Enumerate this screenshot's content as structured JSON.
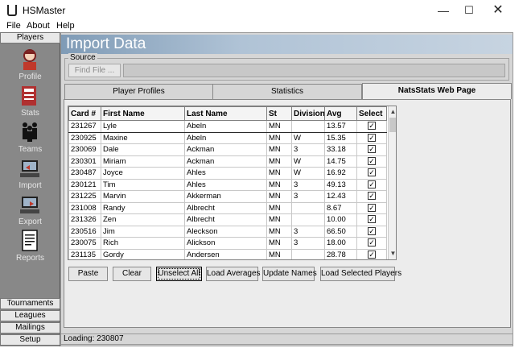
{
  "window": {
    "title": "HSMaster",
    "minimize": "—",
    "maximize": "☐",
    "close": "✕"
  },
  "menu": [
    "File",
    "About",
    "Help"
  ],
  "sidebar": {
    "header": "Players",
    "items": [
      {
        "label": "Profile",
        "icon": "profile-icon"
      },
      {
        "label": "Stats",
        "icon": "stats-icon"
      },
      {
        "label": "Teams",
        "icon": "teams-icon"
      },
      {
        "label": "Import",
        "icon": "import-icon"
      },
      {
        "label": "Export",
        "icon": "export-icon"
      },
      {
        "label": "Reports",
        "icon": "reports-icon"
      }
    ],
    "bottom": [
      "Tournaments",
      "Leagues",
      "Mailings",
      "Setup"
    ]
  },
  "page": {
    "title": "Import Data",
    "source_label": "Source",
    "find_file": "Find File ..."
  },
  "tabs": [
    {
      "label": "Player Profiles",
      "active": false
    },
    {
      "label": "Statistics",
      "active": false
    },
    {
      "label": "NatsStats Web Page",
      "active": true
    }
  ],
  "grid": {
    "columns": [
      "Card #",
      "First Name",
      "Last Name",
      "St",
      "Division",
      "Avg",
      "Select"
    ],
    "rows": [
      [
        "231267",
        "Lyle",
        "Abeln",
        "MN",
        "",
        "13.57",
        true
      ],
      [
        "230925",
        "Maxine",
        "Abeln",
        "MN",
        "W",
        "15.35",
        true
      ],
      [
        "230069",
        "Dale",
        "Ackman",
        "MN",
        "3",
        "33.18",
        true
      ],
      [
        "230301",
        "Miriam",
        "Ackman",
        "MN",
        "W",
        "14.75",
        true
      ],
      [
        "230487",
        "Joyce",
        "Ahles",
        "MN",
        "W",
        "16.92",
        true
      ],
      [
        "230121",
        "Tim",
        "Ahles",
        "MN",
        "3",
        "49.13",
        true
      ],
      [
        "231225",
        "Marvin",
        "Akkerman",
        "MN",
        "3",
        "12.43",
        true
      ],
      [
        "231008",
        "Randy",
        "Albrecht",
        "MN",
        "",
        "8.67",
        true
      ],
      [
        "231326",
        "Zen",
        "Albrecht",
        "MN",
        "",
        "10.00",
        true
      ],
      [
        "230516",
        "Jim",
        "Aleckson",
        "MN",
        "3",
        "66.50",
        true
      ],
      [
        "230075",
        "Rich",
        "Alickson",
        "MN",
        "3",
        "18.00",
        true
      ],
      [
        "231135",
        "Gordy",
        "Andersen",
        "MN",
        "",
        "28.78",
        true
      ]
    ]
  },
  "buttons": {
    "paste": "Paste",
    "clear": "Clear",
    "unselect_all": "Unselect All",
    "load_averages": "Load Averages",
    "update_names": "Update Names",
    "load_selected": "Load Selected Players"
  },
  "status": "Loading: 230807"
}
